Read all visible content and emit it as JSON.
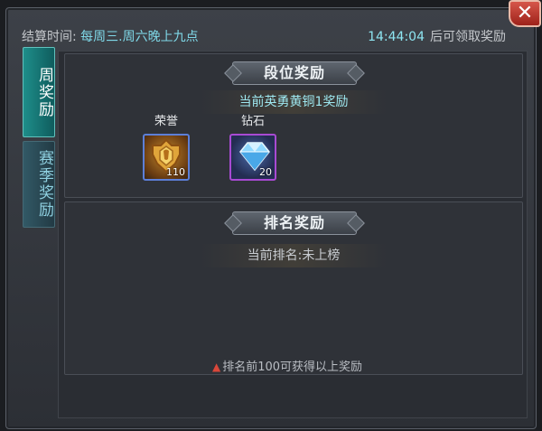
{
  "close": {
    "label": "✕"
  },
  "header": {
    "settle_label": "结算时间:",
    "settle_value": "每周三.周六晚上九点",
    "countdown": "14:44:04",
    "countdown_suffix": "后可领取奖励"
  },
  "tabs": [
    {
      "label": "周奖励",
      "active": true
    },
    {
      "label": "赛季奖励",
      "active": false
    }
  ],
  "rank_section": {
    "banner": "段位奖励",
    "current": "当前英勇黄铜1奖励",
    "rewards": [
      {
        "name": "荣誉",
        "count": "110",
        "icon": "honor-medal-icon"
      },
      {
        "name": "钻石",
        "count": "20",
        "icon": "diamond-icon"
      }
    ]
  },
  "ladder_section": {
    "banner": "排名奖励",
    "current": "当前排名:未上榜",
    "note": "排名前100可获得以上奖励"
  },
  "colors": {
    "accent": "#7fd8e8",
    "close": "#c0392b",
    "active_tab": "#1e8e8a"
  }
}
